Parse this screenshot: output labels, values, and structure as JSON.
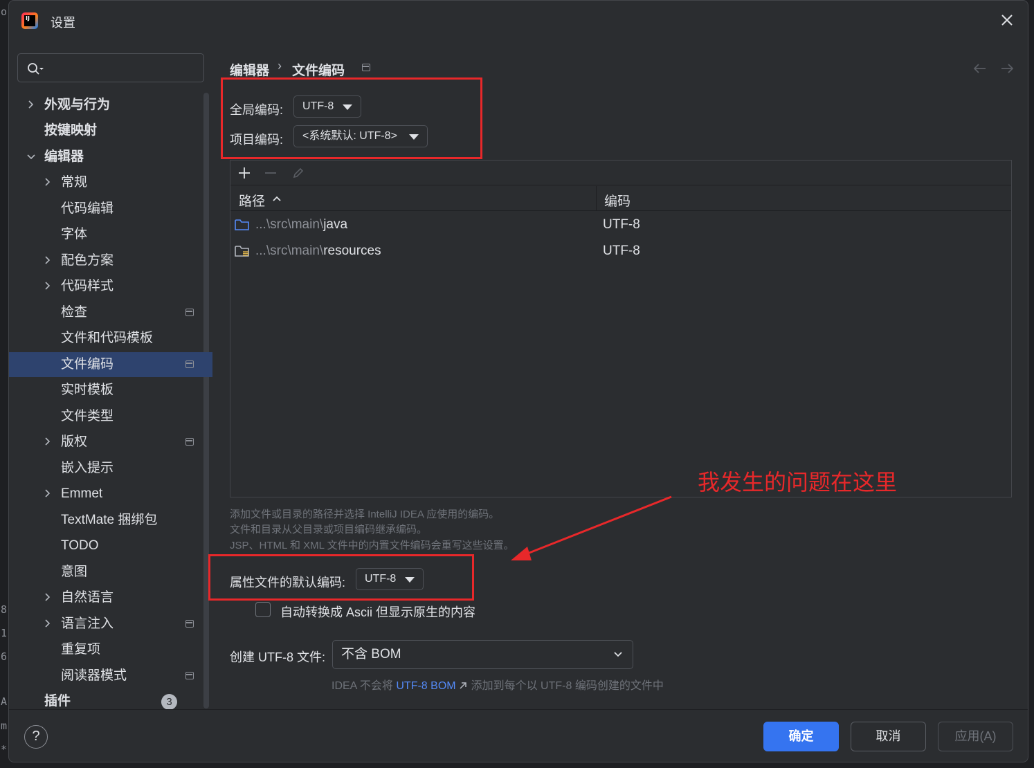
{
  "window": {
    "title": "设置",
    "logo_text": "IJ"
  },
  "search": {
    "placeholder": ""
  },
  "sidebar": {
    "items": [
      {
        "label": "外观与行为",
        "bold": true,
        "arrow": "right",
        "proj": false
      },
      {
        "label": "按键映射",
        "bold": true,
        "arrow": "",
        "proj": false
      },
      {
        "label": "编辑器",
        "bold": true,
        "arrow": "down",
        "proj": false
      },
      {
        "label": "常规",
        "arrow": "right",
        "proj": false
      },
      {
        "label": "代码编辑",
        "arrow": "",
        "proj": false
      },
      {
        "label": "字体",
        "arrow": "",
        "proj": false
      },
      {
        "label": "配色方案",
        "arrow": "right",
        "proj": false
      },
      {
        "label": "代码样式",
        "arrow": "right",
        "proj": false
      },
      {
        "label": "检查",
        "arrow": "",
        "proj": true
      },
      {
        "label": "文件和代码模板",
        "arrow": "",
        "proj": false
      },
      {
        "label": "文件编码",
        "arrow": "",
        "proj": true,
        "selected": true
      },
      {
        "label": "实时模板",
        "arrow": "",
        "proj": false
      },
      {
        "label": "文件类型",
        "arrow": "",
        "proj": false
      },
      {
        "label": "版权",
        "arrow": "right",
        "proj": true
      },
      {
        "label": "嵌入提示",
        "arrow": "",
        "proj": false
      },
      {
        "label": "Emmet",
        "arrow": "right",
        "proj": false
      },
      {
        "label": "TextMate 捆绑包",
        "arrow": "",
        "proj": false
      },
      {
        "label": "TODO",
        "arrow": "",
        "proj": false
      },
      {
        "label": "意图",
        "arrow": "",
        "proj": false
      },
      {
        "label": "自然语言",
        "arrow": "right",
        "proj": false
      },
      {
        "label": "语言注入",
        "arrow": "right",
        "proj": true
      },
      {
        "label": "重复项",
        "arrow": "",
        "proj": false
      },
      {
        "label": "阅读器模式",
        "arrow": "",
        "proj": true
      },
      {
        "label": "插件",
        "bold": true,
        "arrow": "",
        "proj": false,
        "badge": "3"
      }
    ]
  },
  "breadcrumb": {
    "parent": "编辑器",
    "separator": "›",
    "current": "文件编码"
  },
  "encoding": {
    "global_label": "全局编码:",
    "global_value": "UTF-8",
    "project_label": "项目编码:",
    "project_value": "<系统默认: UTF-8>"
  },
  "table": {
    "headers": {
      "path": "路径",
      "encoding": "编码"
    },
    "rows": [
      {
        "path_prefix": "...\\src\\main\\",
        "path_name": "java",
        "encoding": "UTF-8",
        "icon": "folder-icon"
      },
      {
        "path_prefix": "...\\src\\main\\",
        "path_name": "resources",
        "encoding": "UTF-8",
        "icon": "resources-folder-icon"
      }
    ]
  },
  "hints": [
    "添加文件或目录的路径并选择 IntelliJ IDEA 应使用的编码。",
    "文件和目录从父目录或项目编码继承编码。",
    "JSP、HTML 和 XML 文件中的内置文件编码会重写这些设置。"
  ],
  "properties": {
    "label": "属性文件的默认编码:",
    "value": "UTF-8",
    "checkbox_label": "自动转换成 Ascii 但显示原生的内容",
    "checkbox_checked": false
  },
  "bom": {
    "label": "创建 UTF-8 文件:",
    "value": "不含 BOM",
    "note_prefix": "IDEA 不会将",
    "note_link": "UTF-8 BOM",
    "note_suffix": "添加到每个以 UTF-8 编码创建的文件中"
  },
  "annotation": {
    "text": "我发生的问题在这里",
    "color": "#e8282a"
  },
  "footer": {
    "ok": "确定",
    "cancel": "取消",
    "apply": "应用(A)",
    "help": "?"
  },
  "left_edge_chars": [
    "o",
    "8",
    "1",
    "6",
    "A",
    "m",
    "*"
  ],
  "colors": {
    "accent": "#3574f0",
    "selection": "#2e436e",
    "background": "#2b2d30",
    "link": "#548af7"
  }
}
